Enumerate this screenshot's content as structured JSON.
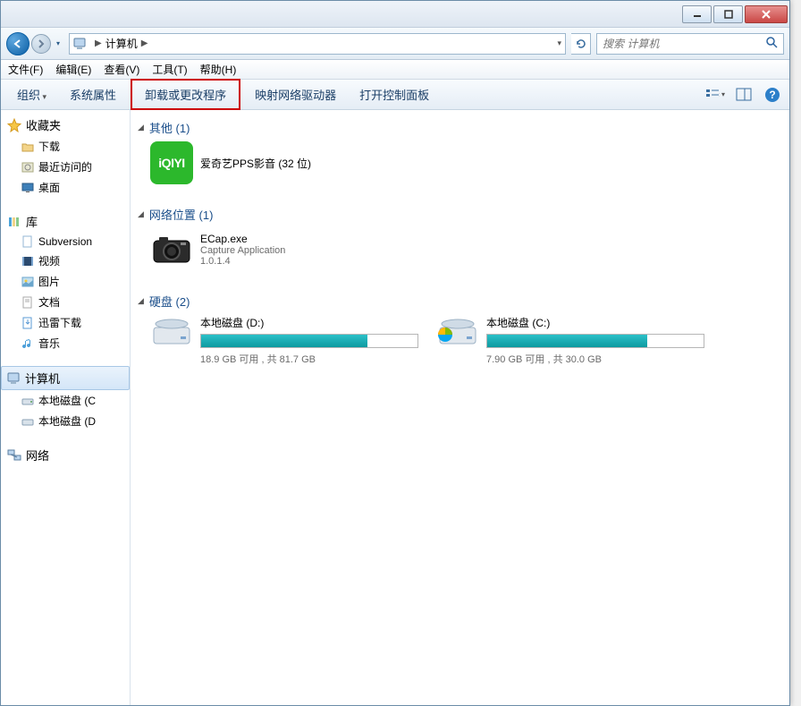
{
  "location": "计算机",
  "search": {
    "placeholder": "搜索 计算机"
  },
  "menu": {
    "file": "文件(F)",
    "edit": "编辑(E)",
    "view": "查看(V)",
    "tools": "工具(T)",
    "help": "帮助(H)"
  },
  "toolbar": {
    "organize": "组织",
    "system_props": "系统属性",
    "uninstall": "卸载或更改程序",
    "map_drive": "映射网络驱动器",
    "control_panel": "打开控制面板"
  },
  "sidebar": {
    "favorites": {
      "label": "收藏夹",
      "items": [
        "下载",
        "最近访问的",
        "桌面"
      ]
    },
    "libraries": {
      "label": "库",
      "items": [
        "Subversion",
        "视频",
        "图片",
        "文档",
        "迅雷下载",
        "音乐"
      ]
    },
    "computer": {
      "label": "计算机",
      "items": [
        "本地磁盘 (C",
        "本地磁盘 (D"
      ]
    },
    "network": {
      "label": "网络"
    }
  },
  "sections": {
    "other": {
      "label": "其他 (1)",
      "items": [
        {
          "title": "爱奇艺PPS影音 (32 位)"
        }
      ]
    },
    "netloc": {
      "label": "网络位置 (1)",
      "items": [
        {
          "title": "ECap.exe",
          "sub1": "Capture Application",
          "sub2": "1.0.1.4"
        }
      ]
    },
    "drives": {
      "label": "硬盘 (2)",
      "items": [
        {
          "title": "本地磁盘 (D:)",
          "sub": "18.9 GB 可用 , 共 81.7 GB",
          "fill": 77,
          "sys": false
        },
        {
          "title": "本地磁盘 (C:)",
          "sub": "7.90 GB 可用 , 共 30.0 GB",
          "fill": 74,
          "sys": true
        }
      ]
    }
  }
}
